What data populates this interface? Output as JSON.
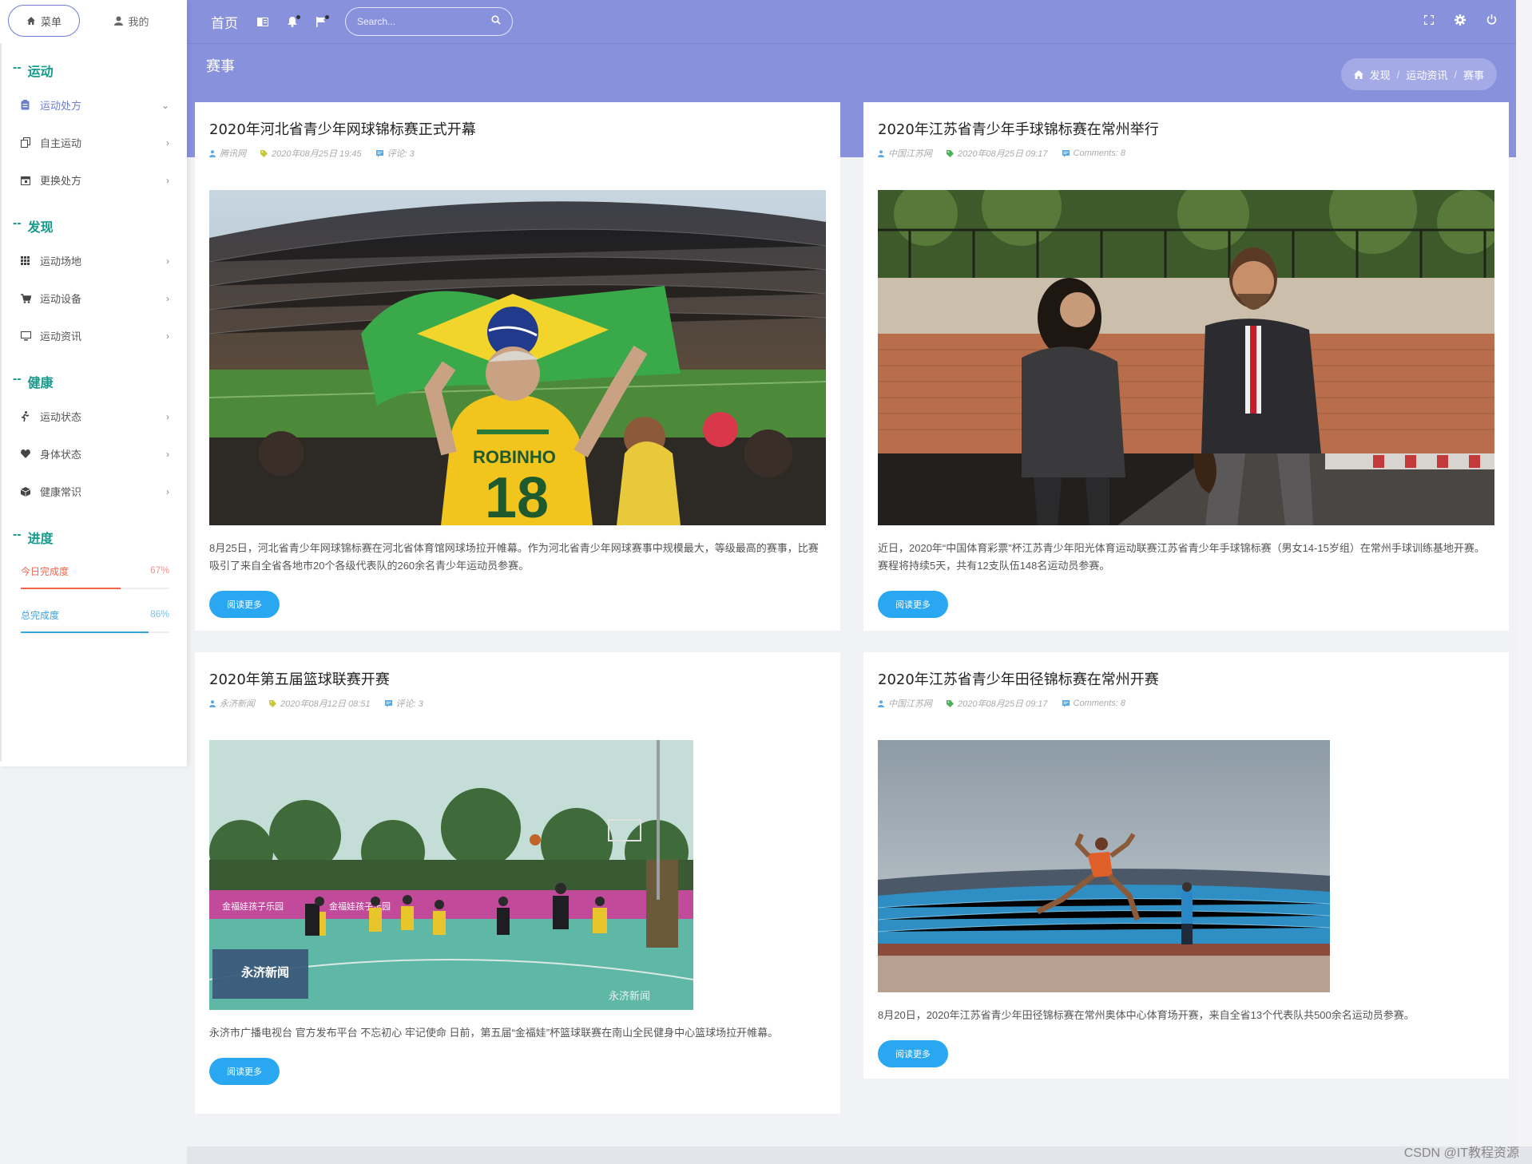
{
  "sidebar": {
    "tabs": [
      {
        "label": "菜单"
      },
      {
        "label": "我的"
      }
    ],
    "sections": {
      "sport": {
        "title": "运动",
        "items": [
          {
            "label": "运动处方"
          },
          {
            "label": "自主运动"
          },
          {
            "label": "更换处方"
          }
        ]
      },
      "discover": {
        "title": "发现",
        "items": [
          {
            "label": "运动场地"
          },
          {
            "label": "运动设备"
          },
          {
            "label": "运动资讯"
          }
        ]
      },
      "health": {
        "title": "健康",
        "items": [
          {
            "label": "运动状态"
          },
          {
            "label": "身体状态"
          },
          {
            "label": "健康常识"
          }
        ]
      },
      "progress": {
        "title": "进度",
        "items": [
          {
            "label": "今日完成度",
            "value": "67%",
            "fraction": 0.67,
            "color": "#f2644c"
          },
          {
            "label": "总完成度",
            "value": "86%",
            "fraction": 0.86,
            "color": "#3aa5dc"
          }
        ]
      }
    },
    "prefix": "--",
    "chevron": "›"
  },
  "header": {
    "home": "首页",
    "search_placeholder": "Search...",
    "page_title": "赛事",
    "breadcrumb": [
      "发现",
      "运动资讯",
      "赛事"
    ],
    "breadcrumb_sep": "/"
  },
  "cards": [
    {
      "title": "2020年河北省青少年网球锦标赛正式开幕",
      "author": "腾讯网",
      "date": "2020年08月25日 19:45",
      "comments": "评论: 3",
      "image_desc": "stadium-fans",
      "text": "8月25日，河北省青少年网球锦标赛在河北省体育馆网球场拉开帷幕。作为河北省青少年网球赛事中规模最大，等级最高的赛事，比赛吸引了来自全省各地市20个各级代表队的260余名青少年运动员参赛。",
      "button": "阅读更多"
    },
    {
      "title": "2020年江苏省青少年手球锦标赛在常州举行",
      "author": "中国江苏网",
      "date": "2020年08月25日 09:17",
      "comments": "Comments: 8",
      "image_desc": "two-people-walking",
      "text": "近日，2020年“中国体育彩票”杯江苏青少年阳光体育运动联赛江苏省青少年手球锦标赛（男女14-15岁组）在常州手球训练基地开赛。赛程将持续5天，共有12支队伍148名运动员参赛。",
      "button": "阅读更多"
    },
    {
      "title": "2020年第五届篮球联赛开赛",
      "author": "永济新闻",
      "date": "2020年08月12日 08:51",
      "comments": "评论: 3",
      "image_desc": "basketball-court",
      "overlay_1": "永济新闻",
      "overlay_2": "永济新闻",
      "text": "永济市广播电视台 官方发布平台 不忘初心 牢记使命 日前，第五届“金福娃”杯篮球联赛在南山全民健身中心篮球场拉开帷幕。",
      "button": "阅读更多"
    },
    {
      "title": "2020年江苏省青少年田径锦标赛在常州开赛",
      "author": "中国江苏网",
      "date": "2020年08月25日 09:17",
      "comments": "Comments: 8",
      "image_desc": "long-jump-athlete",
      "text": "8月20日，2020年江苏省青少年田径锦标赛在常州奥体中心体育场开赛，来自全省13个代表队共500余名运动员参赛。",
      "button": "阅读更多"
    }
  ],
  "watermark": "CSDN @IT教程资源",
  "colors": {
    "header": "#8891dc",
    "accent": "#29a7f0",
    "section": "#159a8c"
  }
}
